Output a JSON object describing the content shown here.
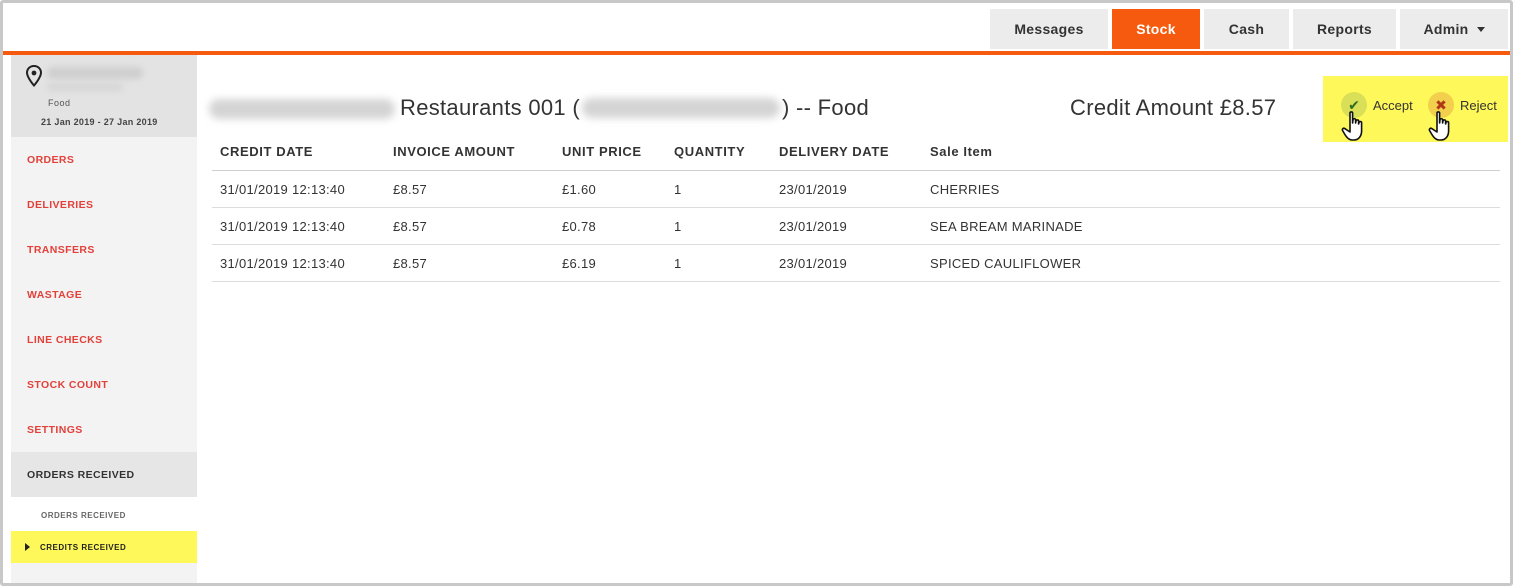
{
  "nav": {
    "tabs": [
      {
        "label": "Messages",
        "active": false
      },
      {
        "label": "Stock",
        "active": true
      },
      {
        "label": "Cash",
        "active": false
      },
      {
        "label": "Reports",
        "active": false
      },
      {
        "label": "Admin",
        "active": false
      }
    ],
    "accent_color": "#f65a0e"
  },
  "sidebar": {
    "location_type": "Food",
    "date_range": "21 Jan 2019 - 27 Jan 2019",
    "items": [
      {
        "label": "ORDERS"
      },
      {
        "label": "DELIVERIES"
      },
      {
        "label": "TRANSFERS"
      },
      {
        "label": "WASTAGE"
      },
      {
        "label": "LINE CHECKS"
      },
      {
        "label": "STOCK COUNT"
      },
      {
        "label": "SETTINGS"
      }
    ],
    "section": {
      "label": "ORDERS RECEIVED"
    },
    "sub_items": [
      {
        "label": "ORDERS RECEIVED"
      },
      {
        "label": "CREDITS RECEIVED",
        "current": true
      }
    ],
    "link_color": "#e2413a",
    "highlight_color": "#fff85a"
  },
  "main": {
    "title_prefix": "Restaurants 001 (",
    "title_suffix": ") -- Food",
    "credit_amount": "Credit Amount £8.57",
    "actions": {
      "accept_label": "Accept",
      "reject_label": "Reject"
    },
    "table": {
      "headers": [
        "CREDIT DATE",
        "INVOICE AMOUNT",
        "UNIT PRICE",
        "QUANTITY",
        "DELIVERY DATE",
        "Sale Item"
      ],
      "rows": [
        [
          "31/01/2019 12:13:40",
          "£8.57",
          "£1.60",
          "1",
          "23/01/2019",
          "CHERRIES"
        ],
        [
          "31/01/2019 12:13:40",
          "£8.57",
          "£0.78",
          "1",
          "23/01/2019",
          "SEA BREAM MARINADE"
        ],
        [
          "31/01/2019 12:13:40",
          "£8.57",
          "£6.19",
          "1",
          "23/01/2019",
          "SPICED CAULIFLOWER"
        ]
      ]
    }
  }
}
